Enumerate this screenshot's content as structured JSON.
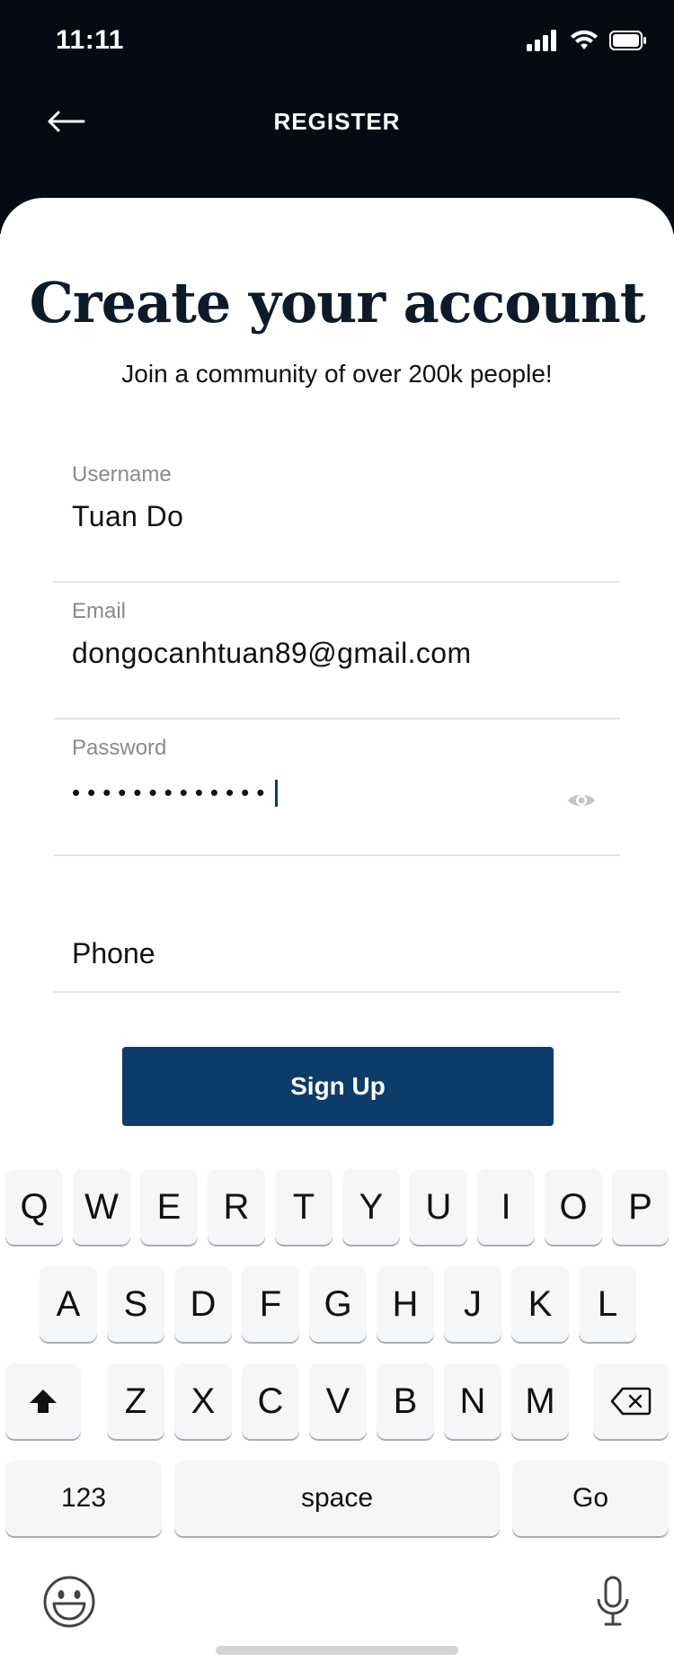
{
  "status_bar": {
    "time": "11:11"
  },
  "header": {
    "title": "REGISTER"
  },
  "card": {
    "heading": "Create your account",
    "subheading": "Join a community of over 200k people!"
  },
  "form": {
    "username": {
      "label": "Username",
      "value": "Tuan Do"
    },
    "email": {
      "label": "Email",
      "value": "dongocanhtuan89@gmail.com"
    },
    "password": {
      "label": "Password",
      "value_masked": "•••••••••••••"
    },
    "phone": {
      "placeholder": "Phone"
    },
    "submit_label": "Sign Up"
  },
  "keyboard": {
    "row1": [
      "Q",
      "W",
      "E",
      "R",
      "T",
      "Y",
      "U",
      "I",
      "O",
      "P"
    ],
    "row2": [
      "A",
      "S",
      "D",
      "F",
      "G",
      "H",
      "J",
      "K",
      "L"
    ],
    "row3": [
      "Z",
      "X",
      "C",
      "V",
      "B",
      "N",
      "M"
    ],
    "numbers_label": "123",
    "space_label": "space",
    "go_label": "Go"
  },
  "icons": {
    "back": "arrow-left-icon",
    "signal": "signal-icon",
    "wifi": "wifi-icon",
    "battery": "battery-icon",
    "eye": "eye-icon",
    "shift": "shift-icon",
    "backspace": "backspace-icon",
    "emoji": "emoji-icon",
    "mic": "microphone-icon"
  },
  "colors": {
    "header_bg": "#060a12",
    "primary_button": "#0d3c6b",
    "heading_text": "#0c1a2a"
  }
}
